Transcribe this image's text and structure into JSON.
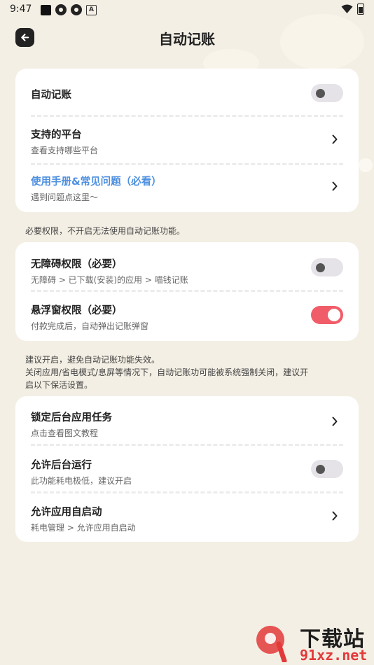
{
  "status_bar": {
    "time": "9:47"
  },
  "header": {
    "title": "自动记账"
  },
  "card1": {
    "auto_record": {
      "title": "自动记账",
      "enabled": false
    },
    "platforms": {
      "title": "支持的平台",
      "subtitle": "查看支持哪些平台"
    },
    "manual": {
      "title": "使用手册&常见问题（必看）",
      "subtitle": "遇到问题点这里～"
    }
  },
  "note1": "必要权限，不开启无法使用自动记账功能。",
  "card2": {
    "accessibility": {
      "title": "无障碍权限（必要）",
      "subtitle": "无障碍 > 已下载(安装)的应用 > 喵钱记账",
      "enabled": false
    },
    "overlay": {
      "title": "悬浮窗权限（必要）",
      "subtitle": "付款完成后，自动弹出记账弹窗",
      "enabled": true
    }
  },
  "note2": {
    "line1": "建议开启，避免自动记账功能失效。",
    "line2": "关闭应用/省电模式/息屏等情况下，自动记账功可能被系统强制关闭，建议开",
    "line3": "启以下保活设置。"
  },
  "card3": {
    "lock_task": {
      "title": "锁定后台应用任务",
      "subtitle": "点击查看图文教程"
    },
    "background": {
      "title": "允许后台运行",
      "subtitle": "此功能耗电极低，建议开启",
      "enabled": false
    },
    "autostart": {
      "title": "允许应用自启动",
      "subtitle": "耗电管理 > 允许应用自启动"
    }
  },
  "watermark": {
    "cn": "下载站",
    "url": "91xz.net"
  },
  "colors": {
    "background": "#f4efe4",
    "accent": "#f05c68",
    "link": "#4d8fe0"
  }
}
